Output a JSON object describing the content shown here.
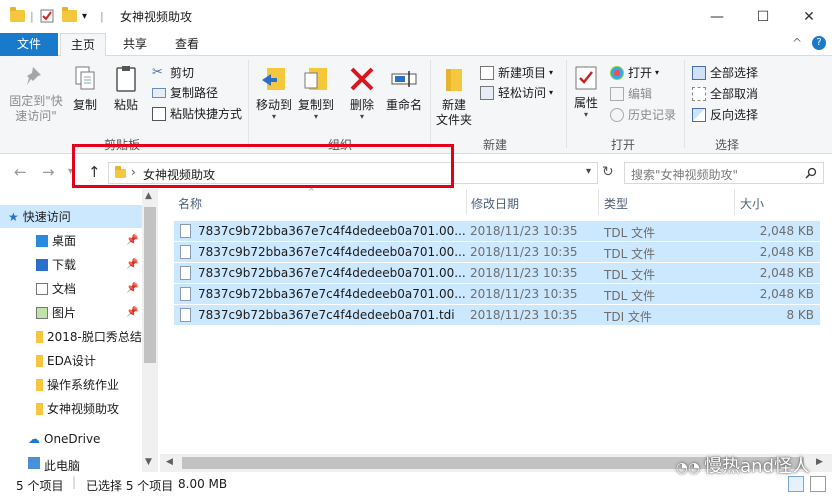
{
  "window": {
    "title": "女神视频助攻",
    "minimize": "—",
    "maximize": "☐",
    "close": "✕"
  },
  "tabs": {
    "file": "文件",
    "home": "主页",
    "share": "共享",
    "view": "查看",
    "collapse": "^"
  },
  "ribbon": {
    "clipboard": {
      "label": "剪贴板",
      "pin": "固定到\"快速访问\"",
      "copy": "复制",
      "paste": "粘贴",
      "cut": "剪切",
      "copy_path": "复制路径",
      "paste_shortcut": "粘贴快捷方式"
    },
    "organize": {
      "label": "组织",
      "move_to": "移动到",
      "copy_to": "复制到",
      "delete": "删除",
      "rename": "重命名"
    },
    "new": {
      "label": "新建",
      "new_folder": "新建\n文件夹",
      "new_item": "新建项目",
      "easy_access": "轻松访问"
    },
    "open": {
      "label": "打开",
      "properties": "属性",
      "open": "打开",
      "edit": "编辑",
      "history": "历史记录"
    },
    "select": {
      "label": "选择",
      "select_all": "全部选择",
      "select_none": "全部取消",
      "invert": "反向选择"
    }
  },
  "address": {
    "path": "女神视频助攻",
    "search_placeholder": "搜索\"女神视频助攻\""
  },
  "nav": {
    "quick_access": "快速访问",
    "items": [
      {
        "label": "桌面"
      },
      {
        "label": "下载"
      },
      {
        "label": "文档"
      },
      {
        "label": "图片"
      },
      {
        "label": "2018-脱口秀总结"
      },
      {
        "label": "EDA设计"
      },
      {
        "label": "操作系统作业"
      },
      {
        "label": "女神视频助攻"
      }
    ],
    "onedrive": "OneDrive",
    "this_pc": "此电脑"
  },
  "columns": {
    "name": "名称",
    "modified": "修改日期",
    "type": "类型",
    "size": "大小"
  },
  "files": [
    {
      "name": "7837c9b72bba367e7c4f4dedeeb0a701.00...",
      "modified": "2018/11/23 10:35",
      "type": "TDL 文件",
      "size": "2,048 KB"
    },
    {
      "name": "7837c9b72bba367e7c4f4dedeeb0a701.00...",
      "modified": "2018/11/23 10:35",
      "type": "TDL 文件",
      "size": "2,048 KB"
    },
    {
      "name": "7837c9b72bba367e7c4f4dedeeb0a701.00...",
      "modified": "2018/11/23 10:35",
      "type": "TDL 文件",
      "size": "2,048 KB"
    },
    {
      "name": "7837c9b72bba367e7c4f4dedeeb0a701.00...",
      "modified": "2018/11/23 10:35",
      "type": "TDL 文件",
      "size": "2,048 KB"
    },
    {
      "name": "7837c9b72bba367e7c4f4dedeeb0a701.tdi",
      "modified": "2018/11/23 10:35",
      "type": "TDI 文件",
      "size": "8 KB"
    }
  ],
  "status": {
    "count": "5 个项目",
    "selected": "已选择 5 个项目",
    "size": "8.00 MB"
  },
  "watermark": "慢热and怪人"
}
